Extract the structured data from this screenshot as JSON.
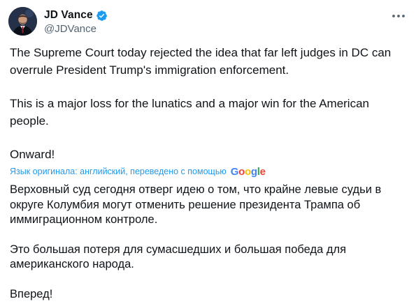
{
  "author": {
    "display_name": "JD Vance",
    "handle": "@JDVance",
    "verified_icon": "verified-badge-icon",
    "verified_color": "#1d9bf0"
  },
  "post": {
    "paragraphs": [
      "The Supreme Court today rejected the idea that far left judges in DC can overrule President Trump's immigration enforcement.",
      "This is a major loss for the lunatics and a major win for the American people.",
      "Onward!"
    ]
  },
  "translation": {
    "label": "Язык оригинала: английский, переведено с помощью",
    "provider_logo": "Google",
    "paragraphs": [
      "Верховный суд сегодня отверг идею о том, что крайне левые судьи в округе Колумбия могут отменить решение президента Трампа об иммиграционном контроле.",
      "Это большая потеря для сумасшедших и большая победа для американского народа.",
      "Вперед!"
    ]
  },
  "menu": {
    "more_icon": "more-horizontal-icon"
  },
  "colors": {
    "text": "#0f1419",
    "secondary": "#536471",
    "link": "#1d9bf0"
  }
}
